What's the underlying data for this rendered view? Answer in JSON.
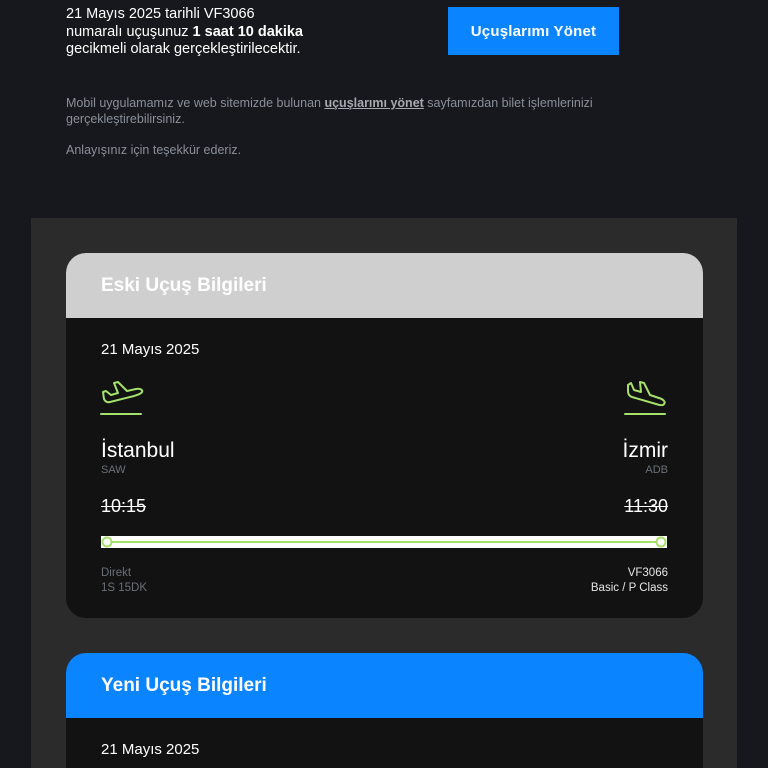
{
  "notice": {
    "line1": "21 Mayıs 2025 tarihli VF3066",
    "line2_prefix": "numaralı uçuşunuz ",
    "delay": "1 saat 10 dakika",
    "line3": "gecikmeli olarak gerçekleştirilecektir."
  },
  "manage_button": "Uçuşlarımı Yönet",
  "info": {
    "prefix": "Mobil uygulamamız ve web sitemizde bulunan ",
    "link": "uçuşlarımı yönet",
    "suffix": " sayfamızdan bilet işlemlerinizi gerçekleştirebilirsiniz."
  },
  "thanks": "Anlayışınız için teşekkür ederiz.",
  "old_flight": {
    "header": "Eski Uçuş Bilgileri",
    "date": "21 Mayıs 2025",
    "from_city": "İstanbul",
    "from_code": "SAW",
    "to_city": "İzmir",
    "to_code": "ADB",
    "dep_time": "10:15",
    "arr_time": "11:30",
    "type": "Direkt",
    "duration": "1S 15DK",
    "flight_no": "VF3066",
    "fare_class": "Basic / P Class"
  },
  "new_flight": {
    "header": "Yeni Uçuş Bilgileri",
    "date": "21 Mayıs 2025"
  },
  "icons": {
    "departure": "airplane-departure-icon",
    "arrival": "airplane-arrival-icon"
  },
  "colors": {
    "accent_blue": "#0a84ff",
    "route_green": "#a4e06a",
    "old_header": "#cfcfcf"
  }
}
